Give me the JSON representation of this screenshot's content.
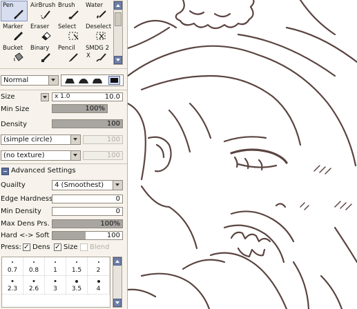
{
  "tools": [
    {
      "label": "Pen",
      "icon": "pen-icon",
      "selected": true
    },
    {
      "label": "AirBrush",
      "icon": "airbrush-icon"
    },
    {
      "label": "Brush",
      "icon": "brush-icon"
    },
    {
      "label": "Water",
      "icon": "water-brush-icon"
    },
    {
      "label": "Marker",
      "icon": "marker-icon"
    },
    {
      "label": "Eraser",
      "icon": "eraser-icon"
    },
    {
      "label": "Select",
      "icon": "select-icon"
    },
    {
      "label": "Deselect",
      "icon": "deselect-icon"
    },
    {
      "label": "Bucket",
      "icon": "bucket-icon"
    },
    {
      "label": "Binary",
      "icon": "binary-pen-icon"
    },
    {
      "label": "Pencil",
      "icon": "pencil-icon"
    },
    {
      "label": "SMDG 2",
      "sublabel": "X",
      "icon": "smudge-icon"
    }
  ],
  "blend_mode": "Normal",
  "size": {
    "label": "Size",
    "multiplier": "x 1.0",
    "value": "10.0"
  },
  "min_size": {
    "label": "Min Size",
    "value": "100%",
    "fill": 1.0
  },
  "density": {
    "label": "Density",
    "value": "100",
    "fill": 1.0
  },
  "shape": {
    "value": "(simple circle)",
    "amount": "100"
  },
  "texture": {
    "value": "(no texture)",
    "amount": "100"
  },
  "advanced": {
    "title": "Advanced Settings",
    "quality_label": "Quailty",
    "quality_value": "4 (Smoothest)",
    "edge_hardness": {
      "label": "Edge Hardness",
      "value": "0",
      "fill": 0.0
    },
    "min_density": {
      "label": "Min Density",
      "value": "0",
      "fill": 0.0
    },
    "max_dens_prs": {
      "label": "Max Dens Prs.",
      "value": "100%",
      "fill": 1.0
    },
    "hard_soft": {
      "label": "Hard <-> Soft",
      "value": "100",
      "fill": 0.48
    },
    "press_label": "Press:",
    "press_dens": "Dens",
    "press_size": "Size",
    "press_blend": "Blend"
  },
  "brush_sizes_row1": [
    "0.7",
    "0.8",
    "1",
    "1.5",
    "2"
  ],
  "brush_sizes_row2": [
    "2.3",
    "2.6",
    "3",
    "3.5",
    "4"
  ],
  "colors": {
    "accent": "#6e7fa8",
    "selected_tool_bg": "#d7def0",
    "line_art": "#5a4440"
  }
}
